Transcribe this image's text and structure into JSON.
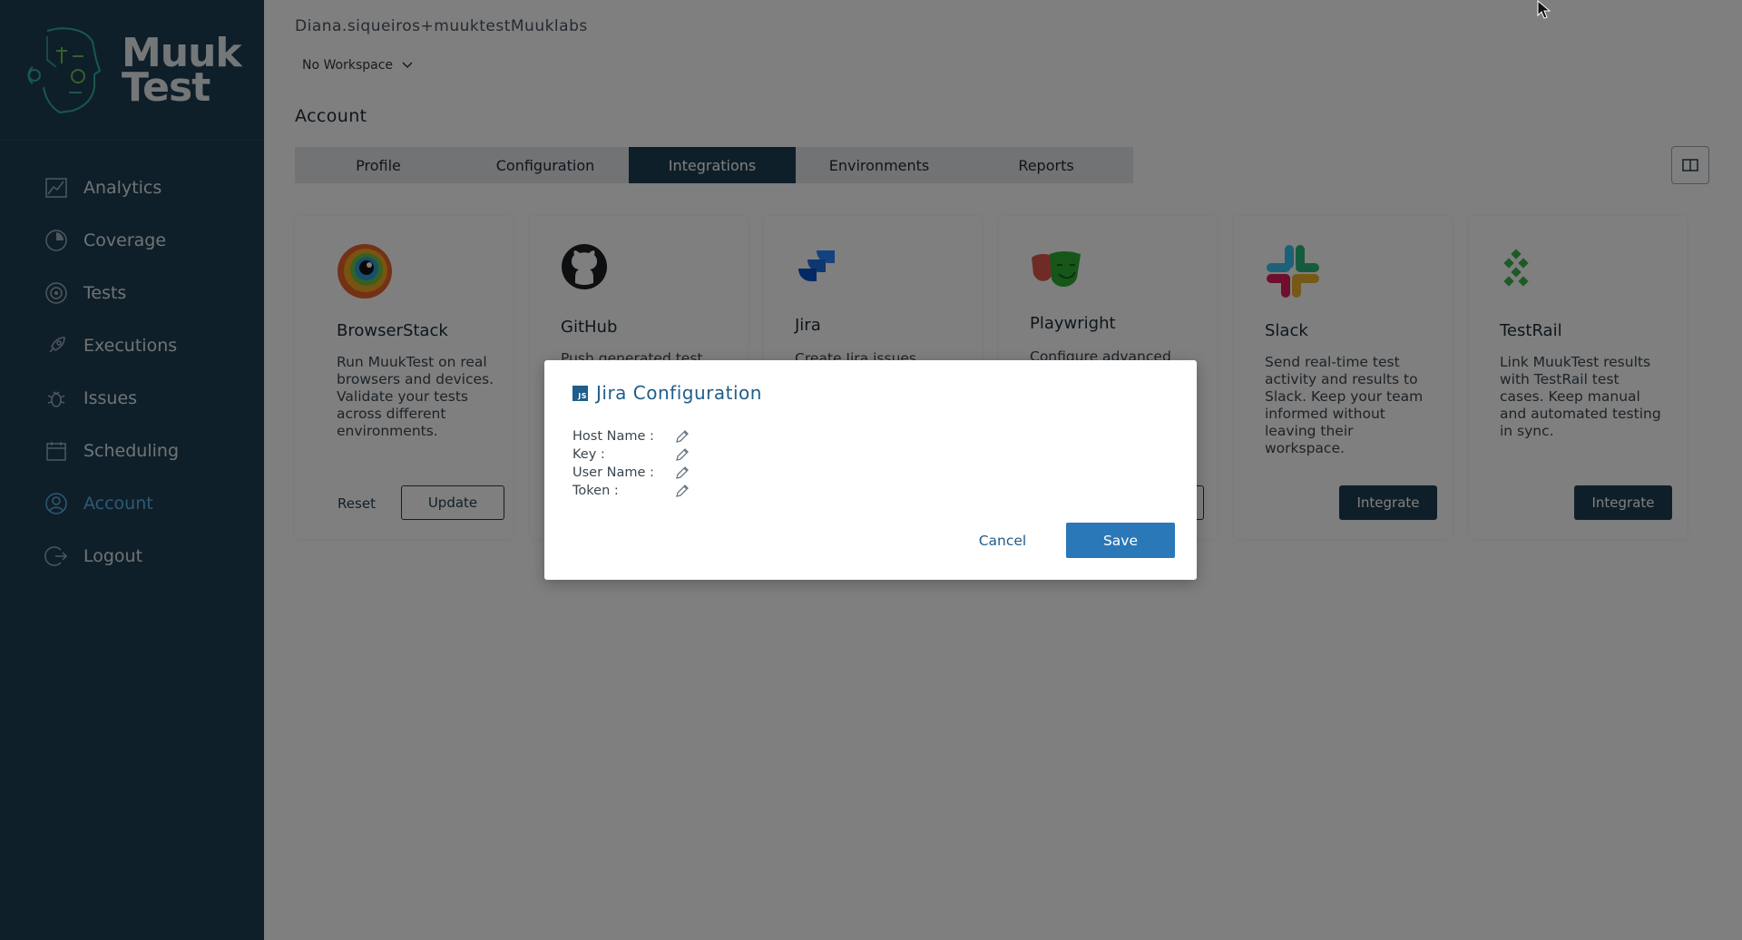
{
  "app": {
    "logo_line1": "Muuk",
    "logo_line2": "Test"
  },
  "sidebar": {
    "items": [
      {
        "label": "Analytics",
        "icon": "analytics-icon"
      },
      {
        "label": "Coverage",
        "icon": "coverage-icon"
      },
      {
        "label": "Tests",
        "icon": "tests-icon"
      },
      {
        "label": "Executions",
        "icon": "rocket-icon"
      },
      {
        "label": "Issues",
        "icon": "bug-icon"
      },
      {
        "label": "Scheduling",
        "icon": "calendar-icon"
      },
      {
        "label": "Account",
        "icon": "user-icon",
        "active": true
      },
      {
        "label": "Logout",
        "icon": "logout-icon"
      }
    ]
  },
  "header": {
    "user": "Diana.siqueiros+muuktestMuuklabs",
    "workspace": "No Workspace",
    "title": "Account"
  },
  "tabs": [
    {
      "label": "Profile"
    },
    {
      "label": "Configuration"
    },
    {
      "label": "Integrations",
      "active": true
    },
    {
      "label": "Environments"
    },
    {
      "label": "Reports"
    }
  ],
  "cards": {
    "browserstack": {
      "name": "BrowserStack",
      "desc": "Run MuukTest on real browsers and devices. Validate your tests across different environments.",
      "reset": "Reset",
      "update": "Update"
    },
    "github": {
      "name": "GitHub",
      "desc": "Push generated test"
    },
    "jira": {
      "name": "Jira",
      "desc": "Create Jira issues"
    },
    "playwright": {
      "name": "Playwright",
      "desc": "Configure advanced"
    },
    "slack": {
      "name": "Slack",
      "desc": "Send real-time test activity and results to Slack. Keep your team informed without leaving their workspace.",
      "button": "Integrate"
    },
    "testrail": {
      "name": "TestRail",
      "desc": "Link MuukTest results with TestRail test cases. Keep manual and automated testing in sync.",
      "button": "Integrate"
    }
  },
  "modal": {
    "icon_text": "JS",
    "title": "Jira Configuration",
    "fields": [
      {
        "label": "Host Name :"
      },
      {
        "label": "Key :"
      },
      {
        "label": "User Name :"
      },
      {
        "label": "Token :"
      }
    ],
    "cancel": "Cancel",
    "save": "Save"
  },
  "colors": {
    "sidebar_bg": "#1e3f52",
    "active_nav": "#5ab4e8",
    "primary": "#1e3f52",
    "modal_accent": "#1f5d8a",
    "save_button": "#2b78b8"
  }
}
